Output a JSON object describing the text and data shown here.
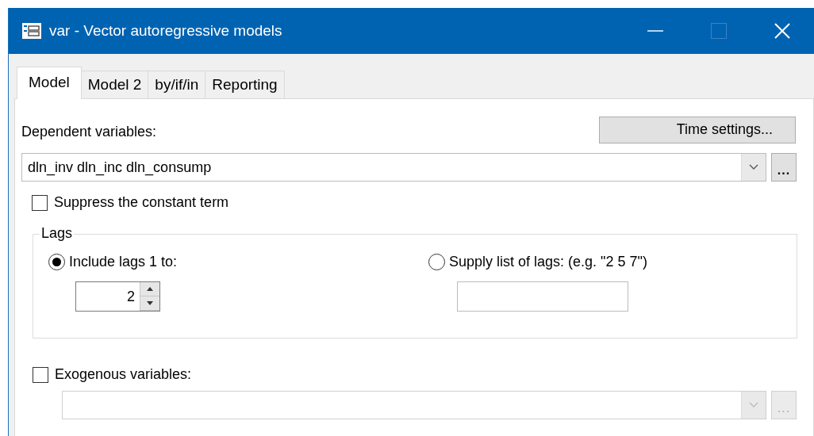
{
  "window": {
    "title": "var - Vector autoregressive models"
  },
  "tabs": [
    {
      "label": "Model",
      "selected": true
    },
    {
      "label": "Model 2",
      "selected": false
    },
    {
      "label": "by/if/in",
      "selected": false
    },
    {
      "label": "Reporting",
      "selected": false
    }
  ],
  "time_settings_button": "Time settings...",
  "dependent": {
    "label": "Dependent variables:",
    "value": "dln_inv dln_inc dln_consump",
    "browse_button": "...",
    "disabled": false
  },
  "suppress_constant": {
    "label": "Suppress the constant term",
    "checked": false
  },
  "lags": {
    "title": "Lags",
    "options": [
      {
        "kind": "spinner",
        "label": "Include lags 1 to:",
        "selected": true,
        "value": "2"
      },
      {
        "kind": "text",
        "label": "Supply list of lags: (e.g. \"2 5 7\")",
        "selected": false
      }
    ]
  },
  "exogenous": {
    "label": "Exogenous variables:",
    "checked": false,
    "browse_button": "...",
    "disabled": true
  }
}
